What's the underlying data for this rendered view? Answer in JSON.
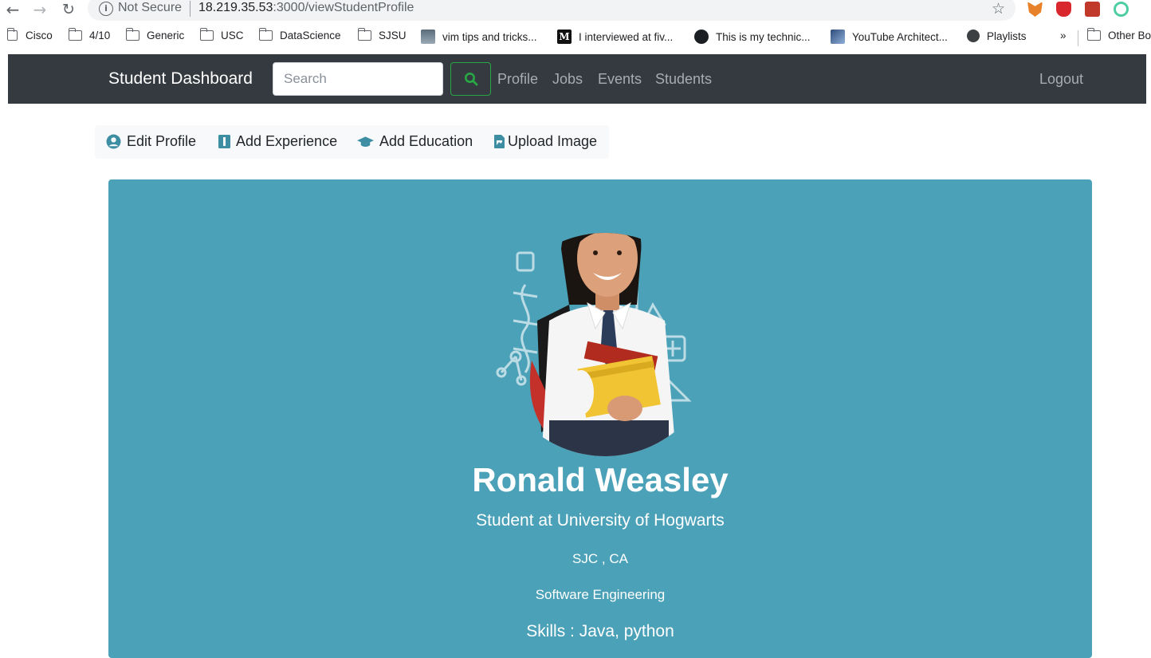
{
  "browser": {
    "security_label": "Not Secure",
    "url_host": "18.219.35.53",
    "url_path": ":3000/viewStudentProfile",
    "bookmarks": [
      {
        "label": "Cisco",
        "icon": "folder-icon"
      },
      {
        "label": "4/10",
        "icon": "folder-icon"
      },
      {
        "label": "Generic",
        "icon": "folder-icon"
      },
      {
        "label": "USC",
        "icon": "folder-icon"
      },
      {
        "label": "DataScience",
        "icon": "folder-icon"
      },
      {
        "label": "SJSU",
        "icon": "folder-icon"
      },
      {
        "label": "vim tips and tricks...",
        "icon": "site-icon"
      },
      {
        "label": "I interviewed at fiv...",
        "icon": "medium-icon"
      },
      {
        "label": "This is my technic...",
        "icon": "github-icon"
      },
      {
        "label": "YouTube Architect...",
        "icon": "site-icon"
      },
      {
        "label": "Playlists",
        "icon": "globe-icon"
      }
    ],
    "bookmarks_overflow": "»",
    "other_bookmarks": "Other Bo"
  },
  "navbar": {
    "brand": "Student Dashboard",
    "search_placeholder": "Search",
    "links": [
      "Profile",
      "Jobs",
      "Events",
      "Students"
    ],
    "logout": "Logout"
  },
  "submenu": {
    "items": [
      {
        "label": "Edit Profile",
        "icon": "user-circle-icon"
      },
      {
        "label": "Add Experience",
        "icon": "id-badge-icon"
      },
      {
        "label": "Add Education",
        "icon": "graduation-cap-icon"
      },
      {
        "label": "Upload Image",
        "icon": "file-image-icon"
      }
    ]
  },
  "profile": {
    "name": "Ronald Weasley",
    "title": "Student at University of Hogwarts",
    "location": "SJC , CA",
    "major": "Software Engineering",
    "skills": "Skills : Java, python"
  },
  "colors": {
    "navbar": "#343a40",
    "card": "#4ba1b7",
    "search_button_border": "#28a745",
    "submenu_icon": "#3d8ea3"
  }
}
